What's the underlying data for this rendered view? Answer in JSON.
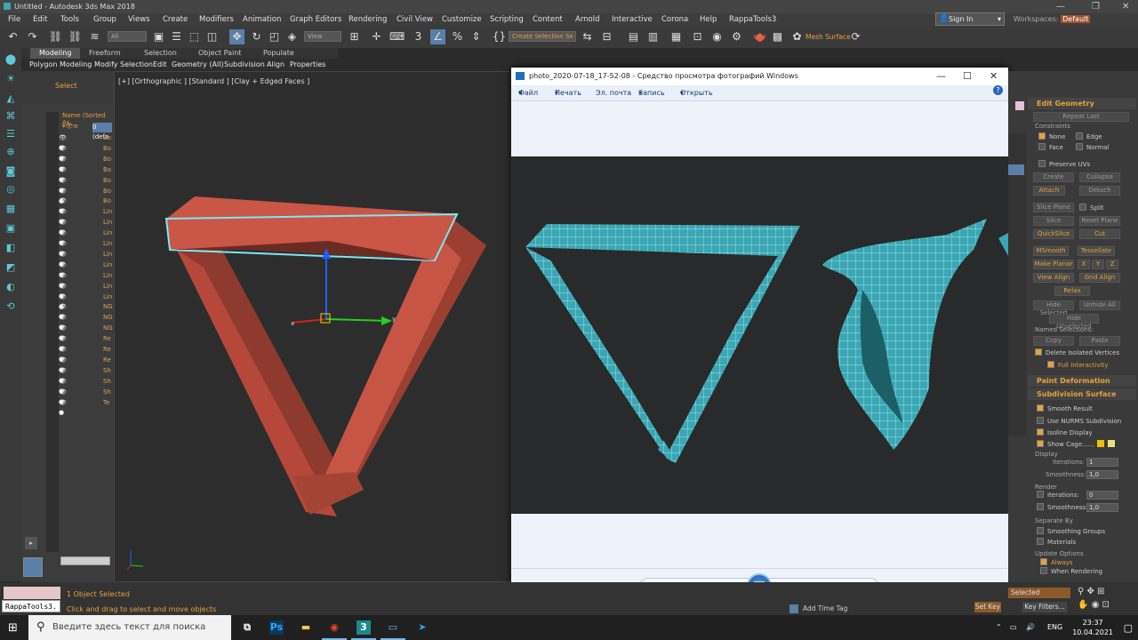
{
  "app": {
    "title": "Untitled - Autodesk 3ds Max 2018"
  },
  "menu": [
    "File",
    "Edit",
    "Tools",
    "Group",
    "Views",
    "Create",
    "Modifiers",
    "Animation",
    "Graph Editors",
    "Rendering",
    "Civil View",
    "Customize",
    "Scripting",
    "Content",
    "Arnold",
    "Interactive",
    "Corona",
    "Help",
    "RappaTools3"
  ],
  "header": {
    "sign_in": "Sign In",
    "workspaces_label": "Workspaces:",
    "workspaces_value": "Default"
  },
  "toolbar": {
    "filter": "All",
    "view": "View",
    "selection_set": "Create Selection Se",
    "mesh_surface": "Mesh Surface"
  },
  "ribbon": {
    "tabs": [
      "Modeling",
      "Freeform",
      "Selection",
      "Object Paint",
      "Populate"
    ],
    "sub": [
      "Polygon Modeling",
      "Modify Selection",
      "Edit",
      "Geometry (All)",
      "Subdivision",
      "Align",
      "Properties"
    ]
  },
  "scene_explorer": {
    "select": "Select",
    "column_header": "Name (Sorted As",
    "layer": "0 (defa",
    "items": [
      "Bo",
      "Bo",
      "Bo",
      "Bo",
      "Bo",
      "Bo",
      "Bo",
      "Lin",
      "Lin",
      "Lin",
      "Lin",
      "Lin",
      "Lin",
      "Lin",
      "Lin",
      "Lin",
      "NG",
      "NG",
      "NG",
      "Re",
      "Re",
      "Re",
      "Sh",
      "Sh",
      "Sh",
      "Te"
    ]
  },
  "viewport": {
    "label": "[+] [Orthographic ] [Standard ] [Clay + Edged Faces ]",
    "axis_x": "x",
    "axis_y": "y"
  },
  "photo_viewer": {
    "title": "photo_2020-07-18_17-52-08 - Средство просмотра фотографий Windows",
    "menu": [
      "Файл",
      "Печать",
      "Эл. почта",
      "Запись",
      "Открыть"
    ]
  },
  "command_panel": {
    "edit_geometry": "Edit Geometry",
    "repeat_last": "Repeat Last",
    "constraints": "Constraints",
    "none": "None",
    "edge": "Edge",
    "face": "Face",
    "normal": "Normal",
    "preserve_uvs": "Preserve UVs",
    "create": "Create",
    "collapse": "Collapse",
    "attach": "Attach",
    "detach": "Detach",
    "slice_plane": "Slice Plane",
    "split": "Split",
    "slice": "Slice",
    "reset_plane": "Reset Plane",
    "quickslice": "QuickSlice",
    "cut": "Cut",
    "msmooth": "MSmooth",
    "tessellate": "Tessellate",
    "make_planar": "Make Planar",
    "x": "X",
    "y": "Y",
    "z": "Z",
    "view_align": "View Align",
    "grid_align": "Grid Align",
    "relax": "Relax",
    "hide_selected": "Hide Selected",
    "unhide_all": "Unhide All",
    "hide_unselected": "Hide Unselected",
    "named_selections": "Named Selections:",
    "copy": "Copy",
    "paste": "Paste",
    "delete_isolated": "Delete Isolated Vertices",
    "full_interactivity": "Full Interactivity",
    "paint_deformation": "Paint Deformation",
    "subdivision_surface": "Subdivision Surface",
    "smooth_result": "Smooth Result",
    "use_nurms": "Use NURMS Subdivision",
    "isoline": "Isoline Display",
    "show_cage": "Show Cage......",
    "display": "Display",
    "iterations_label": "Iterations:",
    "iterations_value": "1",
    "smoothness_label": "Smoothness:",
    "smoothness_value": "1,0",
    "render": "Render",
    "render_iterations_value": "0",
    "render_smoothness_value": "1,0",
    "separate_by": "Separate By",
    "smoothing_groups": "Smoothing Groups",
    "materials": "Materials",
    "update_options": "Update Options",
    "always": "Always",
    "when_rendering": "When Rendering",
    "selected": "Selected",
    "set_key": "Set Key",
    "key_filters": "Key Filters..."
  },
  "status": {
    "objects_selected": "1 Object Selected",
    "hint": "Click and drag to select and move objects",
    "add_time_tag": "Add Time Tag",
    "rappatools": "RappaTools3."
  },
  "taskbar": {
    "search_placeholder": "Введите здесь текст для поиска",
    "lang": "ENG",
    "time": "23:37",
    "date": "10.04.2021"
  }
}
